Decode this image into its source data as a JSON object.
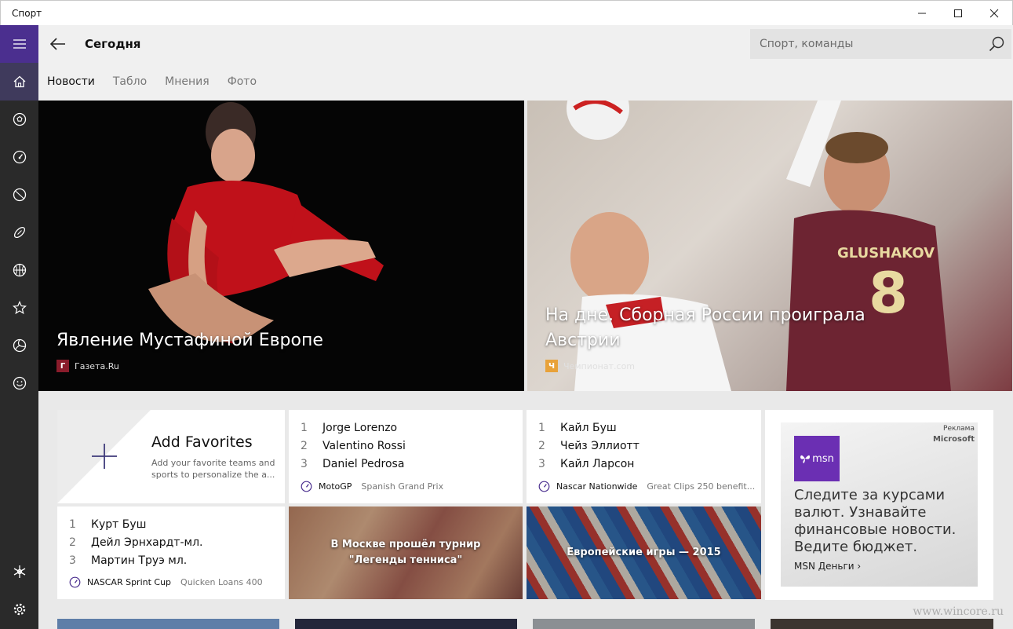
{
  "window": {
    "title": "Спорт"
  },
  "header": {
    "title": "Сегодня",
    "search_placeholder": "Спорт, команды",
    "tabs": [
      {
        "label": "Новости",
        "active": true
      },
      {
        "label": "Табло",
        "active": false
      },
      {
        "label": "Мнения",
        "active": false
      },
      {
        "label": "Фото",
        "active": false
      }
    ]
  },
  "sidebar": {
    "items": [
      {
        "icon": "hamburger-menu-icon"
      },
      {
        "icon": "home-icon"
      },
      {
        "icon": "soccer-ball-icon"
      },
      {
        "icon": "motorsport-gauge-icon"
      },
      {
        "icon": "tennis-ball-icon"
      },
      {
        "icon": "rugby-ball-icon"
      },
      {
        "icon": "basketball-icon"
      },
      {
        "icon": "star-icon"
      },
      {
        "icon": "volleyball-icon"
      },
      {
        "icon": "smiley-icon"
      },
      {
        "icon": "snowflake-icon"
      },
      {
        "icon": "gear-icon"
      }
    ]
  },
  "hero": [
    {
      "title": "Явление Мустафиной Европе",
      "source": "Газета.Ru",
      "source_logo": "Г",
      "source_color": "#8a1c2b"
    },
    {
      "title": "На дне. Сборная России проиграла Австрии",
      "source": "Чемпионат.com",
      "source_logo": "Ч",
      "source_color": "#e8a23a"
    }
  ],
  "favorites": {
    "title": "Add Favorites",
    "description": "Add your favorite teams and sports to personalize the a..."
  },
  "rankings": [
    {
      "items": [
        {
          "num": "1",
          "name": "Jorge Lorenzo"
        },
        {
          "num": "2",
          "name": "Valentino Rossi"
        },
        {
          "num": "3",
          "name": "Daniel Pedrosa"
        }
      ],
      "category": "MotoGP",
      "event": "Spanish Grand Prix"
    },
    {
      "items": [
        {
          "num": "1",
          "name": "Кайл Буш"
        },
        {
          "num": "2",
          "name": "Чейз Эллиотт"
        },
        {
          "num": "3",
          "name": "Кайл Ларсон"
        }
      ],
      "category": "Nascar Nationwide",
      "event": "Great Clips 250 benefit..."
    },
    {
      "items": [
        {
          "num": "1",
          "name": "Курт Буш"
        },
        {
          "num": "2",
          "name": "Дейл Эрнхардт-мл."
        },
        {
          "num": "3",
          "name": "Мартин Труэ мл."
        }
      ],
      "category": "NASCAR Sprint Cup",
      "event": "Quicken Loans 400"
    }
  ],
  "photos": [
    {
      "caption": "В Москве прошёл турнир \"Легенды тенниса\""
    },
    {
      "caption": "Европейские игры — 2015"
    }
  ],
  "ad": {
    "badge": "Реклама",
    "brand": "Microsoft",
    "logo": "msn",
    "text": "Следите за курсами валют. Узнавайте финансовые новости. Ведите бюджет.",
    "link": "MSN Деньги ›"
  },
  "watermark": "www.wincore.ru",
  "colors": {
    "accent": "#4b2f8f",
    "sidebar": "#2a2a2a",
    "msn": "#6b2fb3"
  }
}
